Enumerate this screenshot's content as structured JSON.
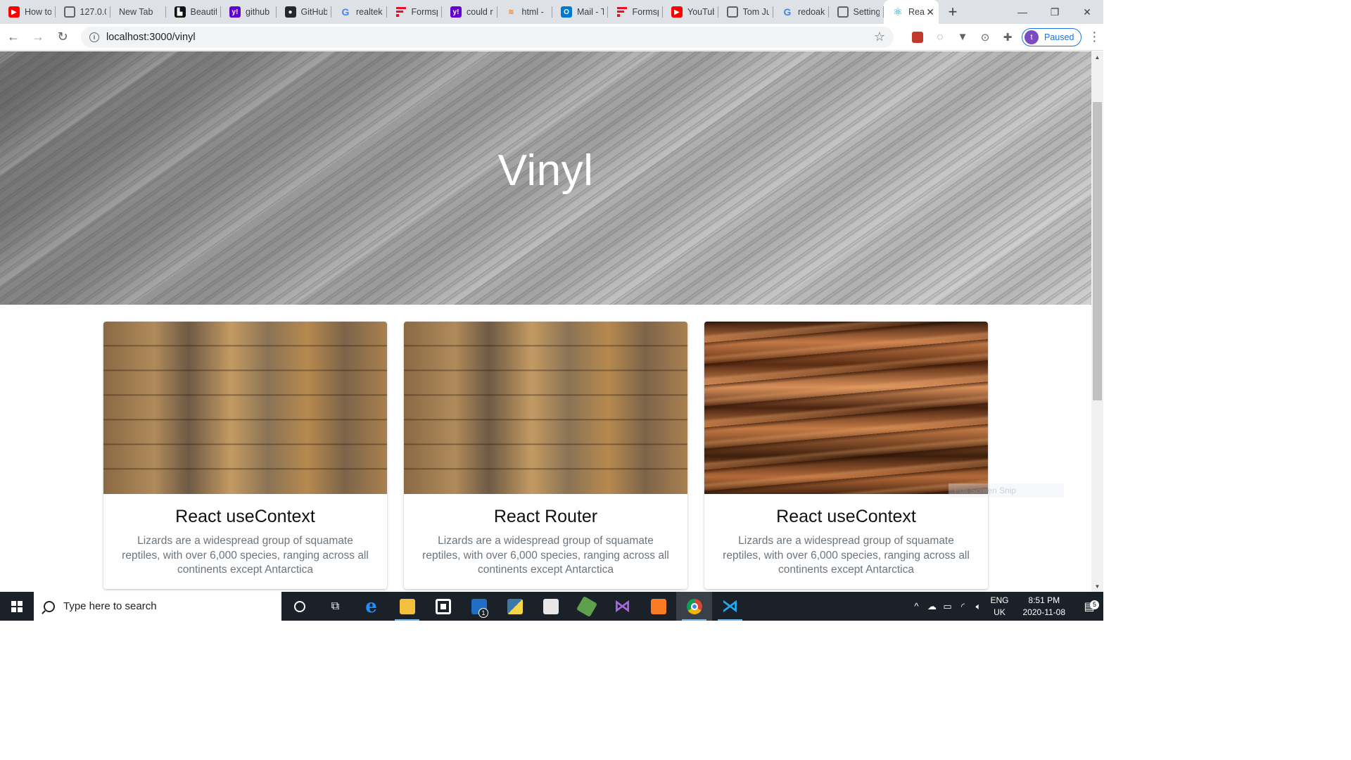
{
  "browser": {
    "tabs": [
      {
        "title": "How to",
        "icon": "youtube-icon"
      },
      {
        "title": "127.0.0",
        "icon": "globe-icon"
      },
      {
        "title": "New Tab",
        "icon": ""
      },
      {
        "title": "Beautif",
        "icon": "bt-icon"
      },
      {
        "title": "github",
        "icon": "yahoo-icon"
      },
      {
        "title": "GitHub",
        "icon": "github-icon"
      },
      {
        "title": "realtek",
        "icon": "google-icon"
      },
      {
        "title": "Formsp",
        "icon": "formspree-icon"
      },
      {
        "title": "could r",
        "icon": "yahoo-icon"
      },
      {
        "title": "html -",
        "icon": "stackoverflow-icon"
      },
      {
        "title": "Mail - T",
        "icon": "outlook-icon"
      },
      {
        "title": "Formsp",
        "icon": "formspree-icon"
      },
      {
        "title": "YouTub",
        "icon": "youtube-icon"
      },
      {
        "title": "Tom Ju",
        "icon": "globe-icon"
      },
      {
        "title": "redoak",
        "icon": "google-icon"
      },
      {
        "title": "Setting",
        "icon": "globe-icon"
      },
      {
        "title": "Rea",
        "icon": "react-icon",
        "active": true
      }
    ],
    "url": "localhost:3000/vinyl",
    "profile_initial": "t",
    "profile_status": "Paused"
  },
  "page": {
    "hero_title": "Vinyl",
    "cards": [
      {
        "title": "React useContext",
        "description": "Lizards are a widespread group of squamate reptiles, with over 6,000 species, ranging across all continents except Antarctica",
        "image": "light-wood-planks"
      },
      {
        "title": "React Router",
        "description": "Lizards are a widespread group of squamate reptiles, with over 6,000 species, ranging across all continents except Antarctica",
        "image": "light-wood-planks"
      },
      {
        "title": "React useContext",
        "description": "Lizards are a widespread group of squamate reptiles, with over 6,000 species, ranging across all continents except Antarctica",
        "image": "dark-wood-grain"
      }
    ],
    "overlay_text": "Full Screen Snip"
  },
  "taskbar": {
    "search_placeholder": "Type here to search",
    "mail_badge": "1",
    "language": "ENG",
    "region": "UK",
    "time": "8:51 PM",
    "date": "2020-11-08",
    "notification_count": "5"
  },
  "colors": {
    "accent": "#1a73e8",
    "taskbar": "#1b2128",
    "card_text": "#6c757d"
  }
}
